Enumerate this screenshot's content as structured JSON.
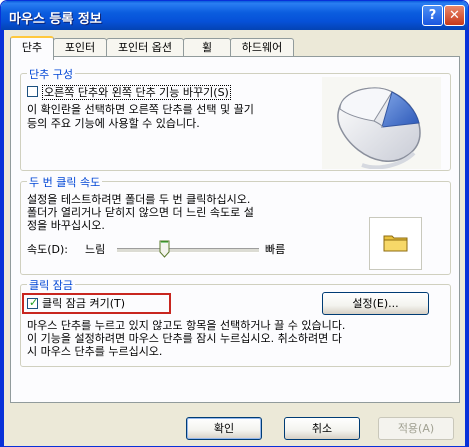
{
  "window": {
    "title": "마우스 등록 정보"
  },
  "title_buttons": {
    "help": "?",
    "close": "✕"
  },
  "tabs": [
    {
      "label": "단추"
    },
    {
      "label": "포인터"
    },
    {
      "label": "포인터 옵션"
    },
    {
      "label": "휠"
    },
    {
      "label": "하드웨어"
    }
  ],
  "button_config": {
    "title": "단추 구성",
    "checkbox_label": "오른쪽 단추와 왼쪽 단추 기능 바꾸기(S)",
    "checked": false,
    "desc_line1": "이 확인란을 선택하면 오른쪽 단추를 선택 및 끌기",
    "desc_line2": "등의 주요 기능에 사용할 수 있습니다."
  },
  "double_click": {
    "title": "두 번 클릭 속도",
    "desc_line1": "설정을 테스트하려면 폴더를 두 번 클릭하십시오.",
    "desc_line2": "폴더가 열리거나 닫히지 않으면 더 느린 속도로 설",
    "desc_line3": "정을 바꾸십시오.",
    "speed_label": "속도(D):",
    "slow_label": "느림",
    "fast_label": "빠름"
  },
  "click_lock": {
    "title": "클릭 잠금",
    "checkbox_label": "클릭 잠금 켜기(T)",
    "checked": true,
    "settings_button": "설정(E)...",
    "desc_line1": "마우스 단추를 누르고 있지 않고도 항목을 선택하거나 끌 수 있습니다.",
    "desc_line2": "이 기능을 설정하려면 마우스 단추를 잠시 누르십시오. 취소하려면 다",
    "desc_line3": "시 마우스 단추를 누르십시오."
  },
  "footer": {
    "ok": "확인",
    "cancel": "취소",
    "apply": "적용(A)"
  },
  "colors": {
    "titlebar": "#0a5ddc",
    "highlight": "#c8261f",
    "group_title": "#0046d5"
  }
}
